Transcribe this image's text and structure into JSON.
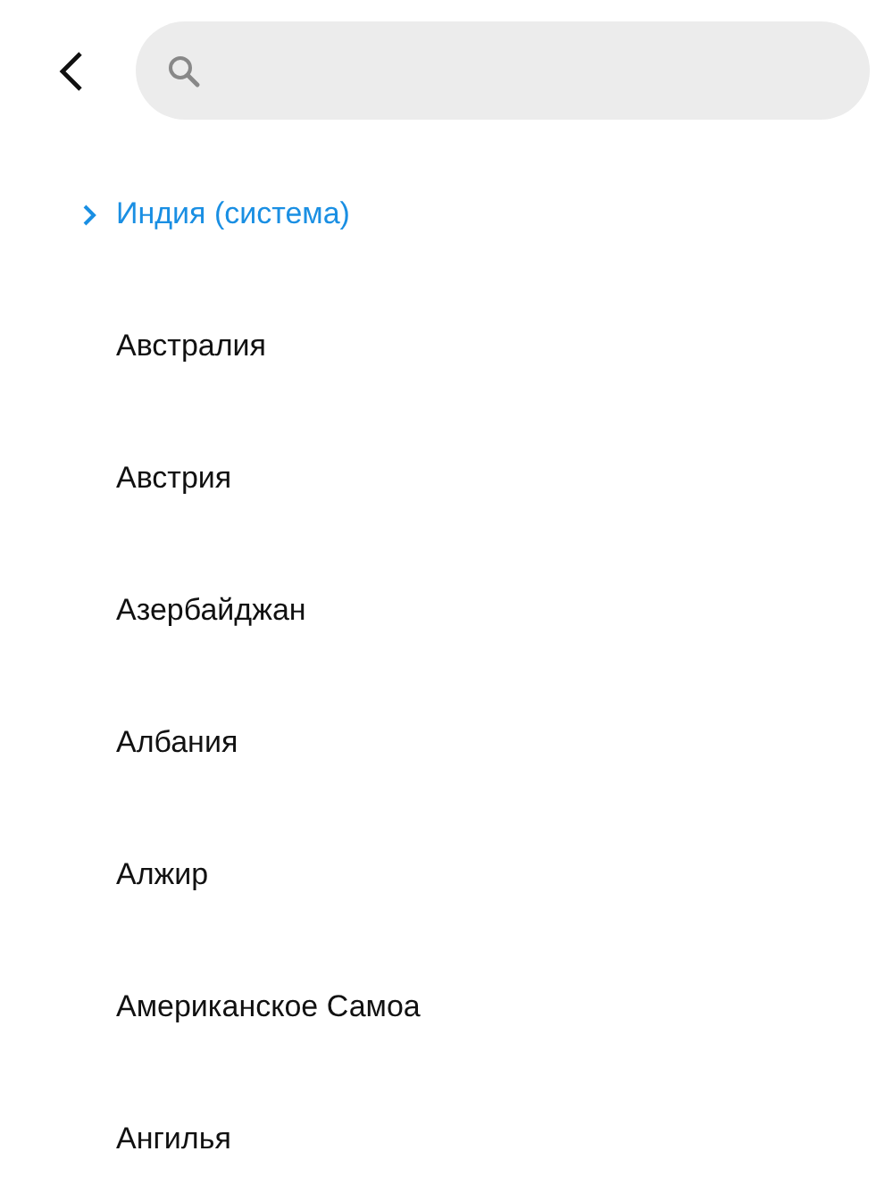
{
  "countries": [
    {
      "label": "Индия (система)",
      "selected": true
    },
    {
      "label": "Австралия",
      "selected": false
    },
    {
      "label": "Австрия",
      "selected": false
    },
    {
      "label": "Азербайджан",
      "selected": false
    },
    {
      "label": "Албания",
      "selected": false
    },
    {
      "label": "Алжир",
      "selected": false
    },
    {
      "label": "Американское Самоа",
      "selected": false
    },
    {
      "label": "Ангилья",
      "selected": false
    }
  ]
}
